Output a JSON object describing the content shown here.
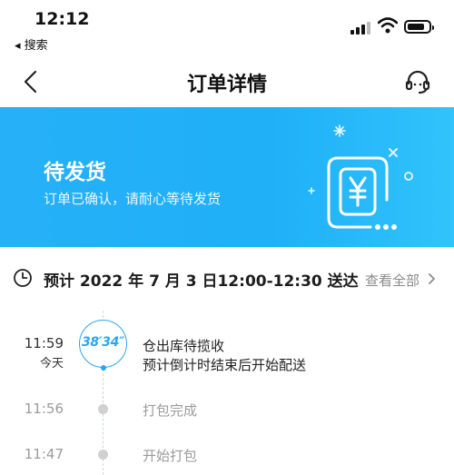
{
  "status_bar": {
    "time": "12:12",
    "back_app_label": "◂ 搜索"
  },
  "nav": {
    "title": "订单详情",
    "back_icon": "chevron-left-icon",
    "service_icon": "headset-icon"
  },
  "banner": {
    "title": "待发货",
    "subtitle": "订单已确认，请耐心等待发货",
    "illustration_icon": "wallet-yen-icon",
    "background_color": "#22b0f7"
  },
  "delivery": {
    "estimate_text": "预计 2022 年 7 月 3 日12:00-12:30 送达",
    "view_all_label": "查看全部",
    "clock_icon": "clock-icon",
    "arrow_icon": "chevron-right-icon"
  },
  "timeline": {
    "countdown": "38′34″",
    "accent_color": "#29a6ef",
    "items": [
      {
        "time": "11:59",
        "day": "今天",
        "line1": "仓出库待揽收",
        "line2": "预计倒计时结束后开始配送",
        "active": true
      },
      {
        "time": "11:56",
        "day": "",
        "line1": "打包完成",
        "line2": "",
        "active": false
      },
      {
        "time": "11:47",
        "day": "",
        "line1": "开始打包",
        "line2": "",
        "active": false
      }
    ]
  }
}
